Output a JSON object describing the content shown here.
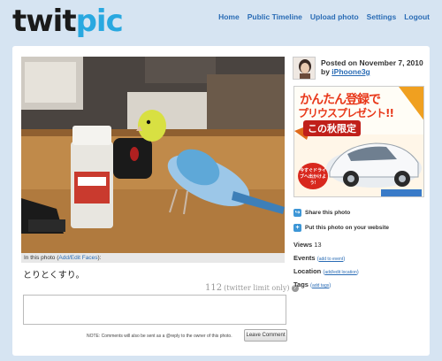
{
  "logo": {
    "part1": "twit",
    "part2": "pic"
  },
  "nav": [
    "Home",
    "Public Timeline",
    "Upload photo",
    "Settings",
    "Logout"
  ],
  "photo": {
    "caption_prefix": "In this photo (",
    "caption_link": "Add/Edit Faces",
    "caption_suffix": "):"
  },
  "message": "とりとくすり。",
  "counter": {
    "remaining": "112",
    "label": "(twitter limit only)",
    "help": "?"
  },
  "comment": {
    "placeholder": "",
    "note": "NOTE: Comments will also be sent as a @reply to the owner of this photo.",
    "button": "Leave Comment"
  },
  "post": {
    "posted_on": "Posted on November 7, 2010",
    "by": "by",
    "user": "iPhoone3g"
  },
  "ad": {
    "line1": "かんたん登録で",
    "line2": "プリウスプレゼント!!",
    "line3": "この秋限定",
    "cta": "今すぐドライブへ出かけよう!"
  },
  "actions": {
    "share": "Share this photo",
    "embed": "Put this photo on your website"
  },
  "views": {
    "label": "Views",
    "count": "13"
  },
  "events": {
    "label": "Events",
    "link": "add to event"
  },
  "location": {
    "label": "Location",
    "link": "add/edit location"
  },
  "tags": {
    "label": "Tags",
    "link": "add tags"
  },
  "colors": {
    "accent": "#29a8e0",
    "link": "#2a6cb5",
    "page_bg": "#d6e4f2"
  }
}
